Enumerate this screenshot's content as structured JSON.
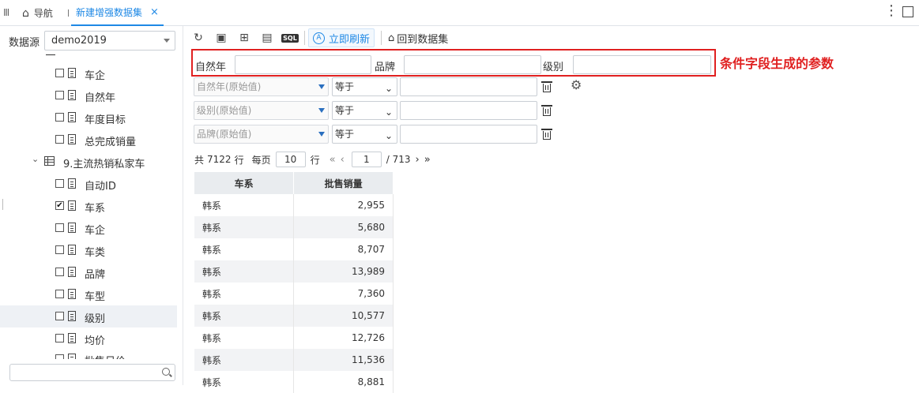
{
  "topbar": {
    "menu_icon": "menu-icon",
    "home_label": "导航",
    "tab_label": "新建增强数据集",
    "close_glyph": "×"
  },
  "datasource": {
    "label": "数据源",
    "value": "demo2019"
  },
  "tree": {
    "items": [
      {
        "label": "车企",
        "checked": false
      },
      {
        "label": "自然年",
        "checked": false
      },
      {
        "label": "年度目标",
        "checked": false
      },
      {
        "label": "总完成销量",
        "checked": false
      }
    ],
    "table_node": "9.主流热销私家车",
    "fields": [
      {
        "label": "自动ID",
        "checked": false
      },
      {
        "label": "车系",
        "checked": true
      },
      {
        "label": "车企",
        "checked": false
      },
      {
        "label": "车类",
        "checked": false
      },
      {
        "label": "品牌",
        "checked": false
      },
      {
        "label": "车型",
        "checked": false
      },
      {
        "label": "级别",
        "checked": false,
        "selected": true
      },
      {
        "label": "均价",
        "checked": false
      },
      {
        "label": "批售日价",
        "checked": false
      }
    ],
    "search_placeholder": ""
  },
  "toolbar": {
    "refresh_label": "立即刷新",
    "back_label": "回到数据集",
    "sql_label": "SQL"
  },
  "params": {
    "year_label": "自然年",
    "brand_label": "品牌",
    "level_label": "级别",
    "annotation": "条件字段生成的参数"
  },
  "filters": [
    {
      "field": "自然年(原始值)",
      "op": "等于"
    },
    {
      "field": "级别(原始值)",
      "op": "等于"
    },
    {
      "field": "品牌(原始值)",
      "op": "等于"
    }
  ],
  "pager": {
    "total_prefix": "共",
    "total": "7122",
    "total_suffix": "行",
    "per_page_label": "每页",
    "per_page": "10",
    "row_label": "行",
    "current": "1",
    "pages": "/ 713"
  },
  "table": {
    "headers": [
      "车系",
      "批售销量"
    ],
    "rows": [
      [
        "韩系",
        "2,955"
      ],
      [
        "韩系",
        "5,680"
      ],
      [
        "韩系",
        "8,707"
      ],
      [
        "韩系",
        "13,989"
      ],
      [
        "韩系",
        "7,360"
      ],
      [
        "韩系",
        "10,577"
      ],
      [
        "韩系",
        "12,726"
      ],
      [
        "韩系",
        "11,536"
      ],
      [
        "韩系",
        "8,881"
      ]
    ]
  }
}
